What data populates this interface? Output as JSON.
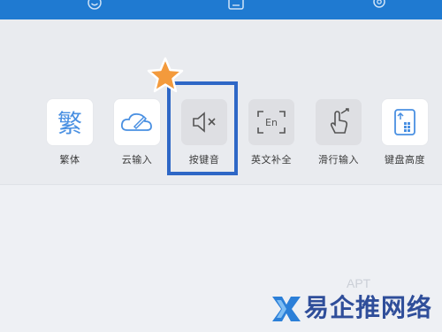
{
  "toolbar_icons": [
    "smiley-icon",
    "keyboard-icon",
    "gear-icon"
  ],
  "tools": [
    {
      "id": "traditional",
      "label": "繁体",
      "glyph": "繁",
      "icon": "traditional-chinese-icon",
      "state": "on"
    },
    {
      "id": "cloud",
      "label": "云输入",
      "icon": "cloud-input-icon",
      "state": "on"
    },
    {
      "id": "keysound",
      "label": "按键音",
      "icon": "speaker-muted-icon",
      "state": "off"
    },
    {
      "id": "english",
      "label": "英文补全",
      "glyph": "En",
      "icon": "english-completion-icon",
      "state": "off"
    },
    {
      "id": "swipe",
      "label": "滑行输入",
      "icon": "swipe-gesture-icon",
      "state": "off"
    },
    {
      "id": "height",
      "label": "键盘高度",
      "icon": "keyboard-height-icon",
      "state": "on"
    }
  ],
  "watermark": {
    "text": "易企推网络",
    "faint": "APT"
  },
  "colors": {
    "topbar": "#1f7ad1",
    "accent": "#4a90e2",
    "highlight": "#2e67c6",
    "star": "#f39a3c"
  }
}
